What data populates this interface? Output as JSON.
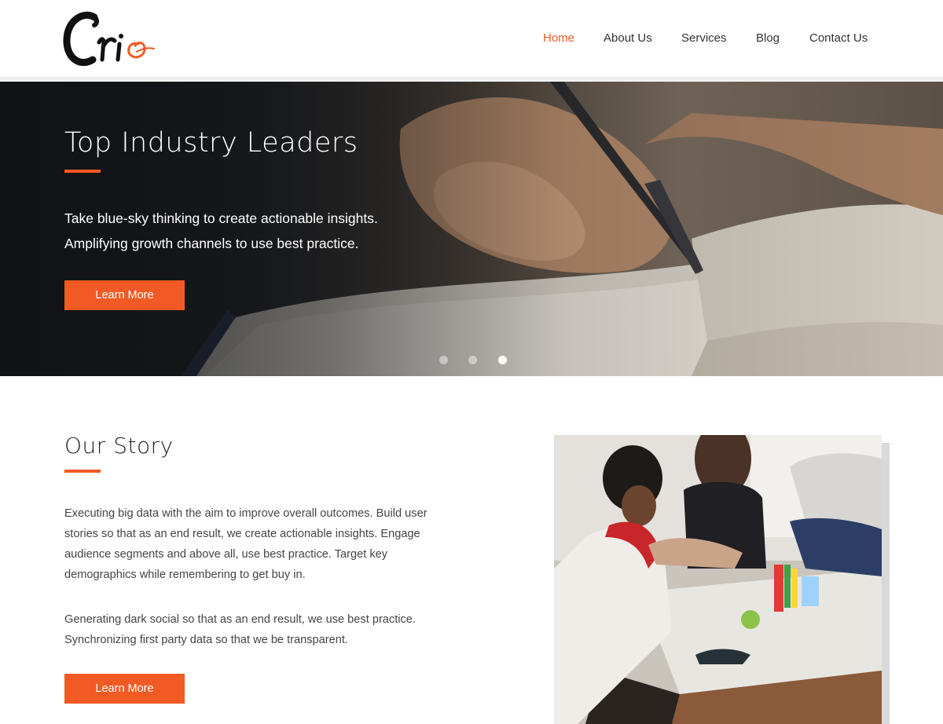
{
  "header": {
    "logo_text": "Crio",
    "nav": [
      {
        "label": "Home",
        "active": true
      },
      {
        "label": "About Us",
        "active": false
      },
      {
        "label": "Services",
        "active": false
      },
      {
        "label": "Blog",
        "active": false
      },
      {
        "label": "Contact Us",
        "active": false
      }
    ]
  },
  "hero": {
    "title": "Top Industry Leaders",
    "line1": "Take blue-sky thinking to create actionable insights.",
    "line2": "Amplifying growth channels to use best practice.",
    "button_label": "Learn More",
    "slides_total": 3,
    "active_slide": 3
  },
  "story": {
    "title": "Our Story",
    "p1_line1": "Executing big data with the aim to improve overall outcomes. Build user",
    "p1_line2": "stories so that as an end result, we create actionable insights. Engage",
    "p1_line3": "audience segments and above all, use best practice. Target key",
    "p1_line4": "demographics while remembering to get buy in.",
    "p2_line1": "Generating dark social so that as an end result, we use best practice.",
    "p2_line2": "Synchronizing first party data so that we be transparent.",
    "button_label": "Learn More"
  },
  "colors": {
    "accent": "#f15a24",
    "text": "#333333",
    "white": "#ffffff"
  }
}
